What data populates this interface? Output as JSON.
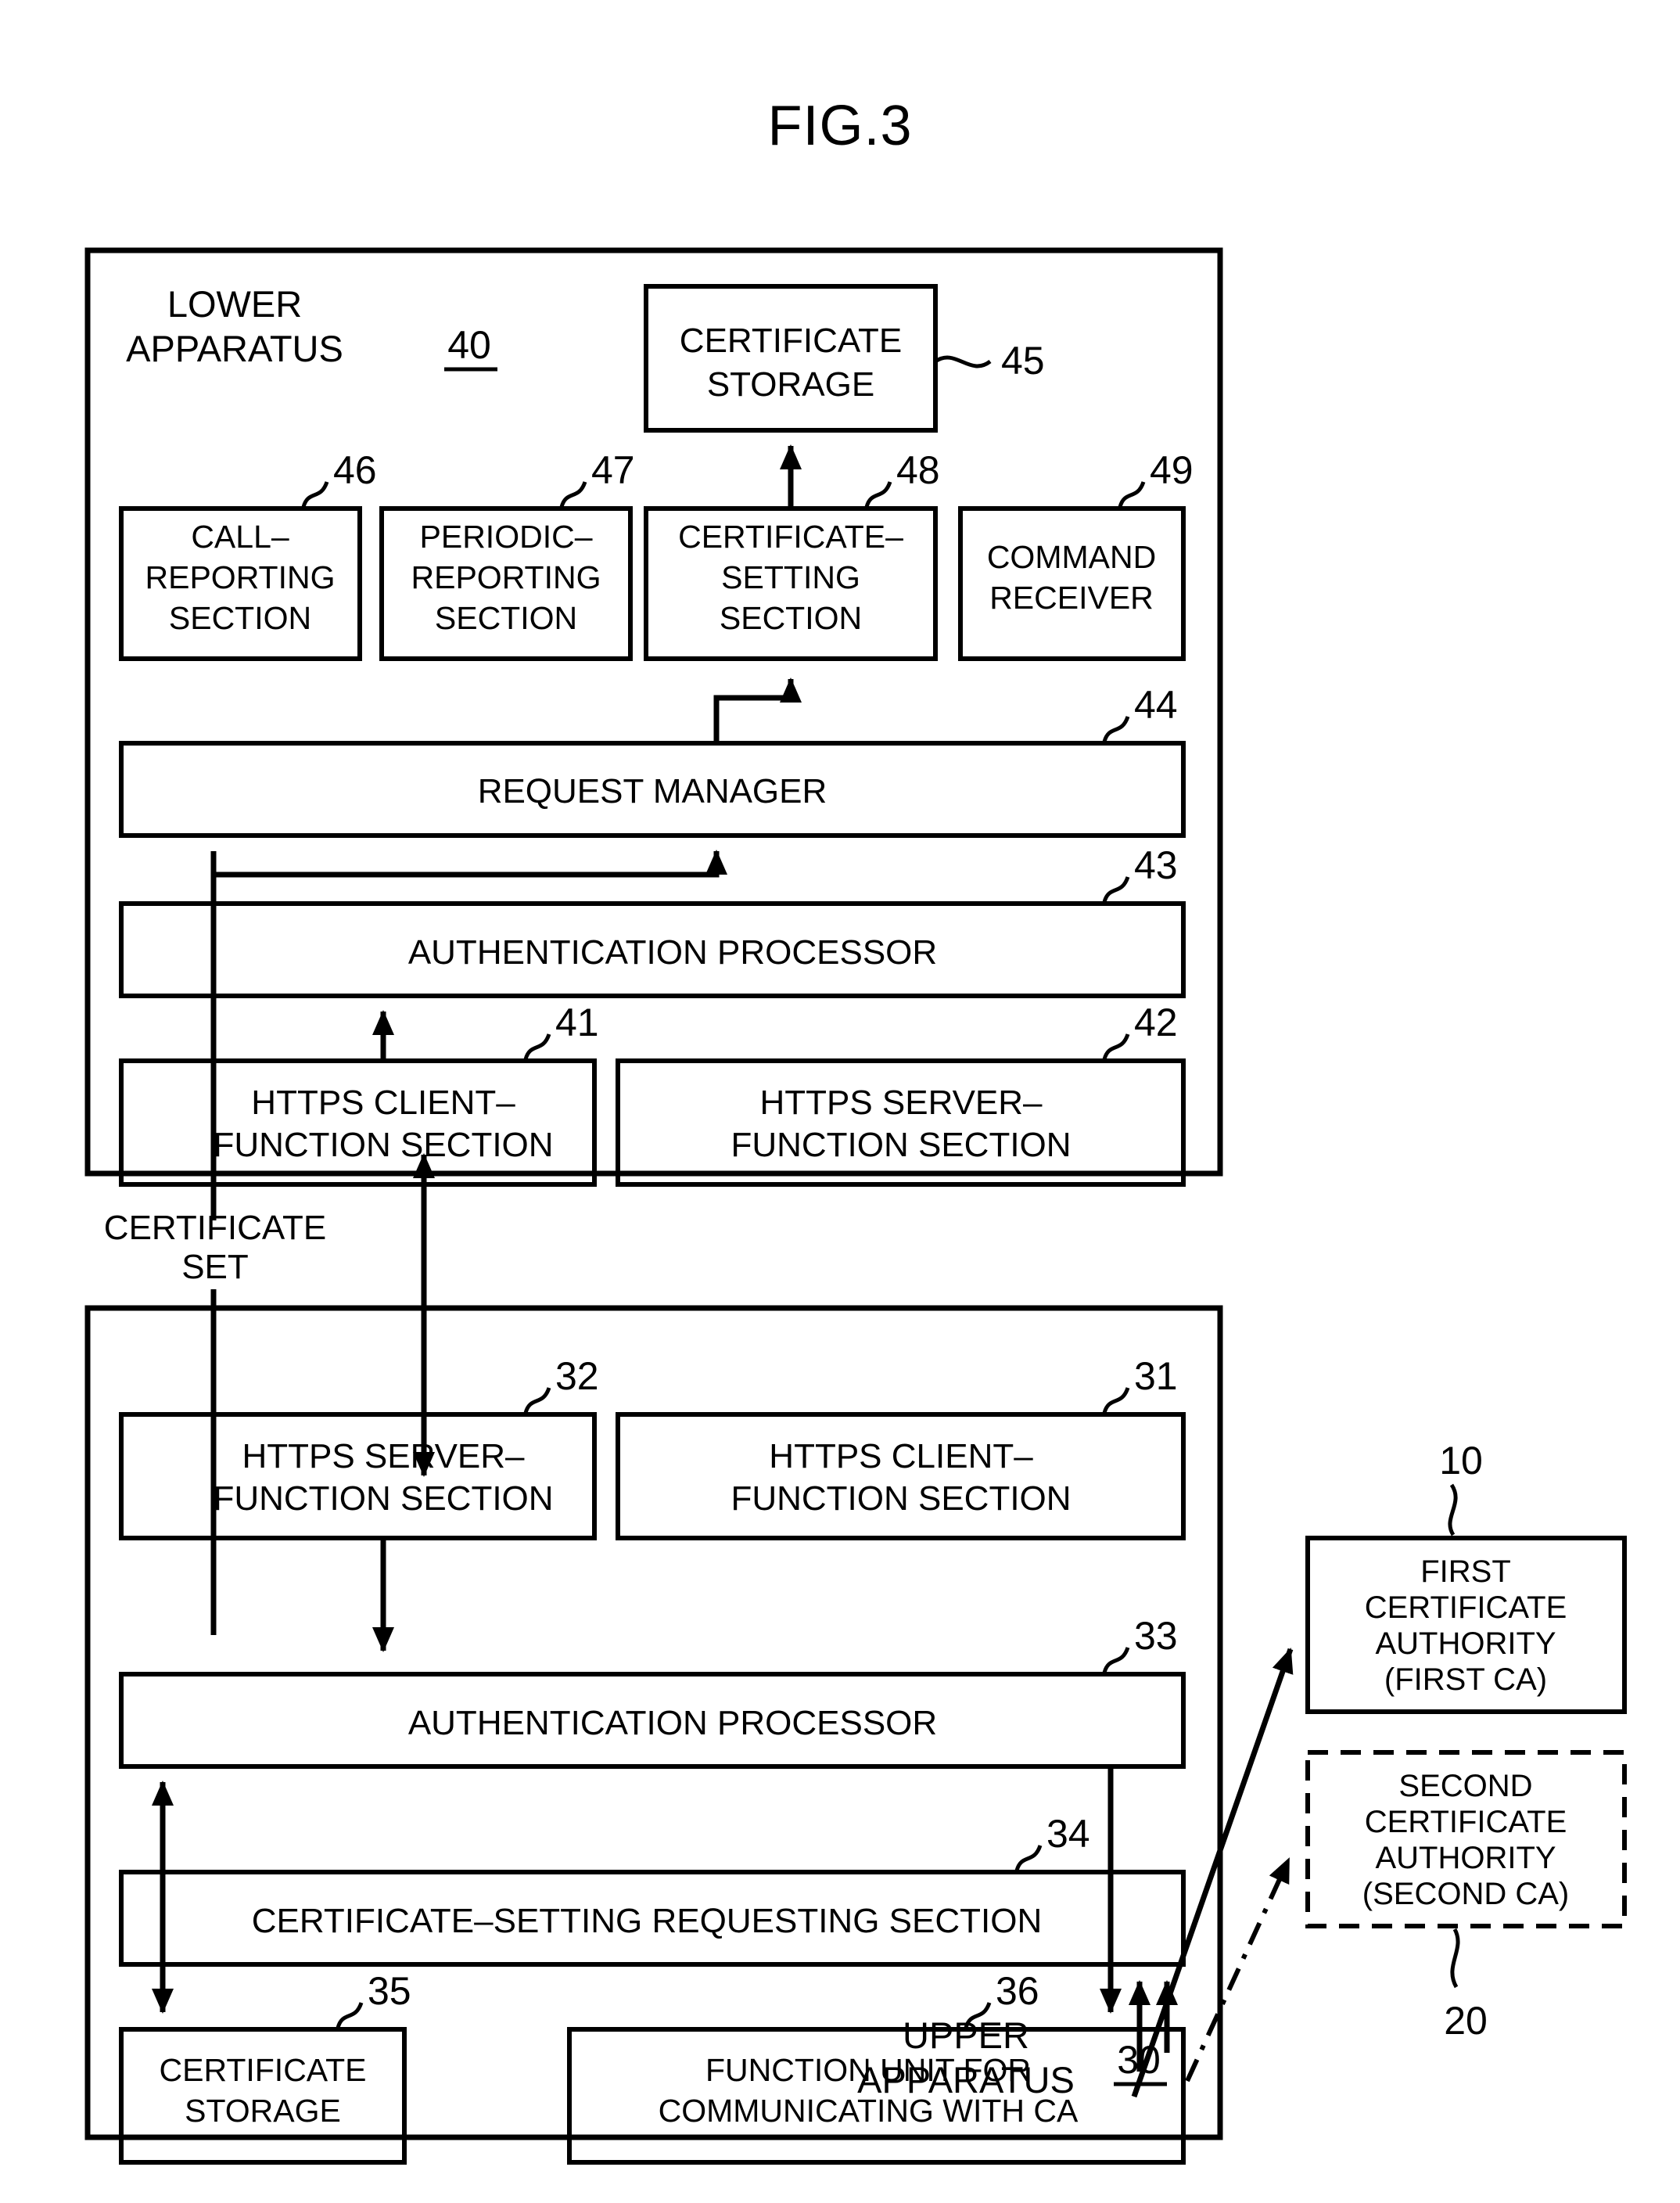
{
  "figure": {
    "title": "FIG.3",
    "type": "patent-block-diagram"
  },
  "lower_apparatus": {
    "label_line1": "LOWER",
    "label_line2": "APPARATUS",
    "ref": "40",
    "blocks": [
      {
        "id": "45",
        "ref": "45",
        "lines": [
          "CERTIFICATE",
          "STORAGE"
        ]
      },
      {
        "id": "46",
        "ref": "46",
        "lines": [
          "CALL–",
          "REPORTING",
          "SECTION"
        ]
      },
      {
        "id": "47",
        "ref": "47",
        "lines": [
          "PERIODIC–",
          "REPORTING",
          "SECTION"
        ]
      },
      {
        "id": "48",
        "ref": "48",
        "lines": [
          "CERTIFICATE–",
          "SETTING",
          "SECTION"
        ]
      },
      {
        "id": "49",
        "ref": "49",
        "lines": [
          "COMMAND",
          "RECEIVER"
        ]
      },
      {
        "id": "44",
        "ref": "44",
        "lines": [
          "REQUEST MANAGER"
        ]
      },
      {
        "id": "43",
        "ref": "43",
        "lines": [
          "AUTHENTICATION PROCESSOR"
        ]
      },
      {
        "id": "41",
        "ref": "41",
        "lines": [
          "HTTPS CLIENT–",
          "FUNCTION SECTION"
        ]
      },
      {
        "id": "42",
        "ref": "42",
        "lines": [
          "HTTPS SERVER–",
          "FUNCTION SECTION"
        ]
      }
    ]
  },
  "upper_apparatus": {
    "label_line1": "UPPER",
    "label_line2": "APPARATUS",
    "ref": "30",
    "blocks": [
      {
        "id": "32",
        "ref": "32",
        "lines": [
          "HTTPS SERVER–",
          "FUNCTION SECTION"
        ]
      },
      {
        "id": "31",
        "ref": "31",
        "lines": [
          "HTTPS CLIENT–",
          "FUNCTION SECTION"
        ]
      },
      {
        "id": "33",
        "ref": "33",
        "lines": [
          "AUTHENTICATION PROCESSOR"
        ]
      },
      {
        "id": "34",
        "ref": "34",
        "lines": [
          "CERTIFICATE–SETTING REQUESTING SECTION"
        ]
      },
      {
        "id": "35",
        "ref": "35",
        "lines": [
          "CERTIFICATE",
          "STORAGE"
        ]
      },
      {
        "id": "36",
        "ref": "36",
        "lines": [
          "FUNCTION UNIT FOR",
          "COMMUNICATING WITH CA"
        ]
      }
    ]
  },
  "certificate_authorities": [
    {
      "id": "first-ca",
      "ref": "10",
      "lines": [
        "FIRST",
        "CERTIFICATE",
        "AUTHORITY",
        "(FIRST CA)"
      ],
      "border": "solid"
    },
    {
      "id": "second-ca",
      "ref": "20",
      "lines": [
        "SECOND",
        "CERTIFICATE",
        "AUTHORITY",
        "(SECOND CA)"
      ],
      "border": "dashed"
    }
  ],
  "annotations": {
    "certificate_set_line1": "CERTIFICATE",
    "certificate_set_line2": "SET"
  },
  "colors": {
    "ink": "#000000",
    "paper": "#ffffff"
  }
}
